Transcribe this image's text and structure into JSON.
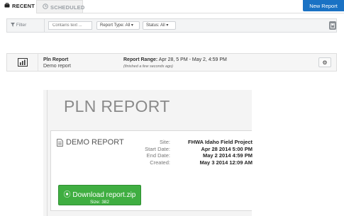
{
  "tabs": [
    {
      "label": "RECENT",
      "icon": "briefcase-icon",
      "active": true
    },
    {
      "label": "SCHEDULED",
      "icon": "clock-icon",
      "active": false
    }
  ],
  "header": {
    "new_report_label": "New Report",
    "accent": "#1a72c4"
  },
  "filter": {
    "label": "Filter",
    "search_placeholder": "Contains text ...",
    "report_type": "Report Type: All",
    "status": "Status: All"
  },
  "report_row": {
    "name": "Pln Report",
    "description": "Demo report",
    "range_label": "Report Range:",
    "range_value": "Apr 28, 5 PM - May 2, 4:59 PM",
    "finished": "(finished a few seconds ago)"
  },
  "report_page": {
    "title": "PLN REPORT",
    "card_title": "DEMO REPORT",
    "meta_labels": [
      "Site:",
      "Start Date:",
      "End Date:",
      "Created:"
    ],
    "meta_values": [
      "FHWA Idaho Field Project",
      "Apr 28 2014 5:00 PM",
      "May 2 2014 4:59 PM",
      "May 3 2014 12:09 AM"
    ],
    "download_label": "Download report.zip",
    "download_size": "Size: 382",
    "download_color": "#3fae41"
  }
}
